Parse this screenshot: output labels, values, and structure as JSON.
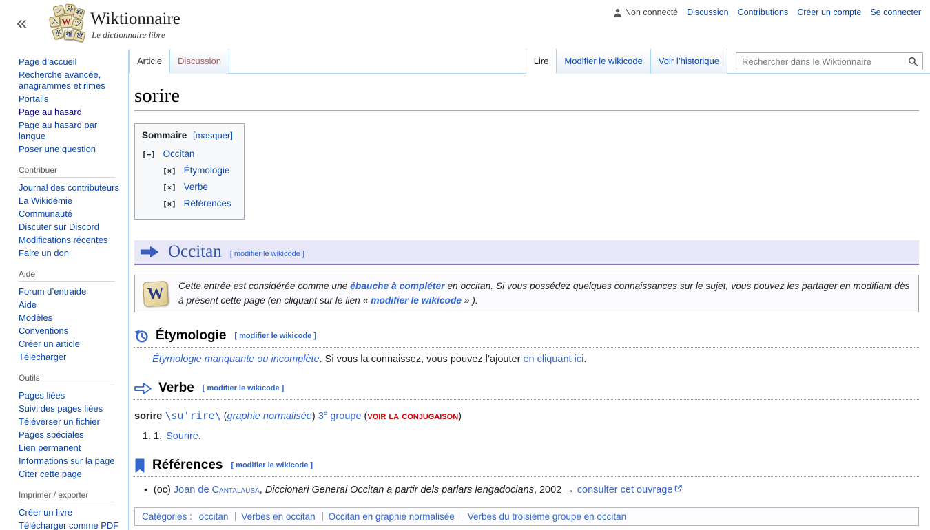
{
  "header": {
    "collapse_label": "«",
    "site_title": "Wiktionnaire",
    "site_subtitle": "Le dictionnaire libre",
    "logo_tiles": [
      "シ",
      "外",
      "判",
      "入",
      "W",
      "ツ",
      "水",
      "维",
      "世"
    ],
    "personal_bar": {
      "status": "Non connecté",
      "links": [
        "Discussion",
        "Contributions",
        "Créer un compte",
        "Se connecter"
      ]
    }
  },
  "tabs": {
    "article": "Article",
    "discussion": "Discussion",
    "read": "Lire",
    "edit": "Modifier le wikicode",
    "history": "Voir l’historique",
    "search_placeholder": "Rechercher dans le Wiktionnaire"
  },
  "sidebar": {
    "sections": [
      {
        "title": "",
        "items": [
          "Page d’accueil",
          "Recherche avancée, anagrammes et rimes",
          "Portails",
          "Page au hasard",
          "Page au hasard par langue",
          "Poser une question"
        ]
      },
      {
        "title": "Contribuer",
        "items": [
          "Journal des contributeurs",
          "La Wikidémie",
          "Communauté",
          "Discuter sur Discord",
          "Modifications récentes",
          "Faire un don"
        ]
      },
      {
        "title": "Aide",
        "items": [
          "Forum d’entraide",
          "Aide",
          "Modèles",
          "Conventions",
          "Créer un article",
          "Télécharger"
        ]
      },
      {
        "title": "Outils",
        "items": [
          "Pages liées",
          "Suivi des pages liées",
          "Téléverser un fichier",
          "Pages spéciales",
          "Lien permanent",
          "Informations sur la page",
          "Citer cette page"
        ]
      },
      {
        "title": "Imprimer / exporter",
        "items": [
          "Créer un livre",
          "Télécharger comme PDF"
        ]
      }
    ]
  },
  "content": {
    "page_title": "sorire",
    "edit_label": "[ modifier le wikicode ]",
    "toc": {
      "title": "Sommaire",
      "hide": "[masquer]",
      "items": [
        {
          "toggle": "[−]",
          "label": "Occitan"
        },
        {
          "toggle": "[×]",
          "label": "Étymologie"
        },
        {
          "toggle": "[×]",
          "label": "Verbe"
        },
        {
          "toggle": "[×]",
          "label": "Références"
        }
      ]
    },
    "language": {
      "title": "Occitan"
    },
    "stub": {
      "text1": "Cette entrée est considérée comme une ",
      "link1": "ébauche à compléter",
      "text2": " en occitan. Si vous possédez quelques connaissances sur le sujet, vous pouvez les partager en modifiant dès à présent cette page (en cliquant sur le lien « ",
      "link2": "modifier le wikicode",
      "text3": " » )."
    },
    "etymology": {
      "title": "Étymologie",
      "link_missing": "Étymologie manquante ou incomplète",
      "text": ". Si vous la connaissez, vous pouvez l’ajouter ",
      "link_add": "en cliquant ici",
      "period": "."
    },
    "verb": {
      "title": "Verbe",
      "word": "sorire",
      "pronunciation": "\\su'rire\\",
      "open1": "(",
      "graphie": "graphie normalisée",
      "close1": ") ",
      "group_num": "3",
      "group_sup": "e",
      "group_rest": " groupe",
      "open2": " (",
      "conjugation": "voir la conjugaison",
      "close2": ")",
      "def_number": "1.",
      "def_link": "Sourire",
      "def_period": "."
    },
    "references": {
      "title": "Références",
      "lang_tag": "(oc) ",
      "author_first": "Joan de ",
      "author_last": "Cantalausa",
      "sep1": ", ",
      "work_title": "Diccionari General Occitan a partir dels parlars lengadocians",
      "sep2": ", 2002 → ",
      "link_consult": "consulter cet ouvrage"
    },
    "categories": {
      "label": "Catégories :",
      "items": [
        "occitan",
        "Verbes en occitan",
        "Occitan en graphie normalisée",
        "Verbes du troisième groupe en occitan"
      ]
    }
  }
}
